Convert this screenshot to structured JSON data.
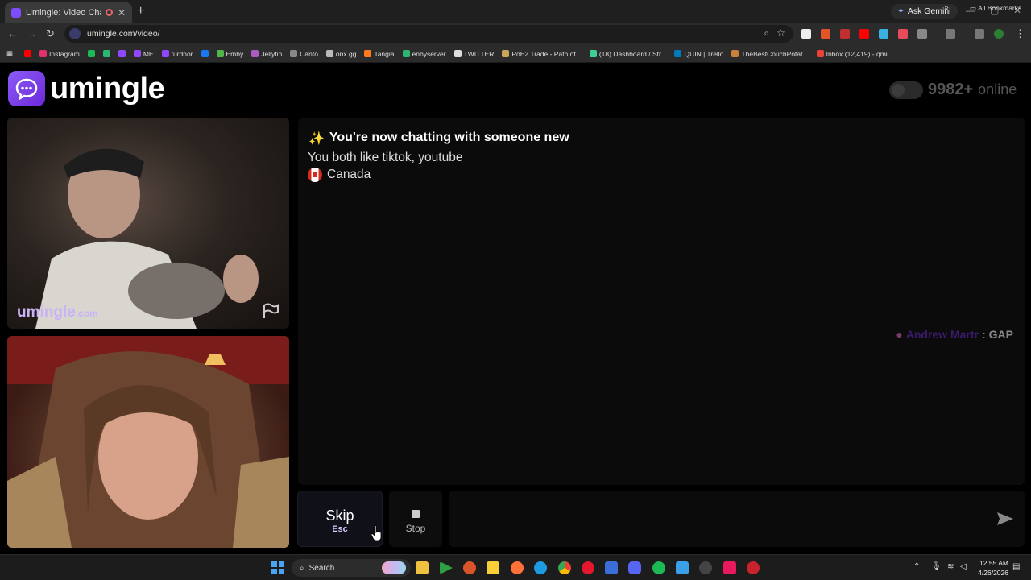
{
  "browser": {
    "tab_title": "Umingle: Video Chat with S",
    "new_tab_label": "+",
    "ask_gemini": "Ask Gemini",
    "url": "umingle.com/video/"
  },
  "bookmarks": [
    {
      "label": "",
      "icon": "youtube-icon",
      "color": "#ff0000"
    },
    {
      "label": "Instagram",
      "icon": "instagram-icon",
      "color": "#e1306c"
    },
    {
      "label": "",
      "icon": "spotify-icon",
      "color": "#1db954"
    },
    {
      "label": "",
      "icon": "bookmark-icon",
      "color": "#2bb673"
    },
    {
      "label": "",
      "icon": "twitch-icon",
      "color": "#9146ff"
    },
    {
      "label": "ME",
      "icon": "twitch-icon",
      "color": "#9146ff"
    },
    {
      "label": "turdnor",
      "icon": "twitch-icon",
      "color": "#9146ff"
    },
    {
      "label": "",
      "icon": "facebook-icon",
      "color": "#1877f2"
    },
    {
      "label": "Emby",
      "icon": "emby-icon",
      "color": "#52b54b"
    },
    {
      "label": "Jellyfin",
      "icon": "jellyfin-icon",
      "color": "#aa5cc3"
    },
    {
      "label": "Canto",
      "icon": "folder-icon",
      "color": "#888888"
    },
    {
      "label": "onx.gg",
      "icon": "onx-icon",
      "color": "#bbbbbb"
    },
    {
      "label": "Tangia",
      "icon": "tangia-icon",
      "color": "#ff7a1a"
    },
    {
      "label": "enbyserver",
      "icon": "server-icon",
      "color": "#2bb673"
    },
    {
      "label": "TWITTER",
      "icon": "x-icon",
      "color": "#dddddd"
    },
    {
      "label": "PoE2 Trade - Path of...",
      "icon": "poe-icon",
      "color": "#c9a55c"
    },
    {
      "label": "(18) Dashboard / Str...",
      "icon": "dashboard-icon",
      "color": "#3ccf91"
    },
    {
      "label": "QUIN | Trello",
      "icon": "trello-icon",
      "color": "#0079bf"
    },
    {
      "label": "TheBestCouchPotat...",
      "icon": "potato-icon",
      "color": "#c9803a"
    },
    {
      "label": "Inbox (12,419) - qmi...",
      "icon": "gmail-icon",
      "color": "#ea4335"
    }
  ],
  "all_bookmarks": "All Bookmarks",
  "app": {
    "logo_text": "umingle",
    "online_count": "9982+",
    "online_word": "online",
    "watermark_main": "umingle",
    "watermark_suffix": ".com"
  },
  "chat": {
    "sparkle": "✨",
    "header": "You're now chatting with someone new",
    "interests": "You both like tiktok, youtube",
    "country": "Canada",
    "message_name": "Andrew Martr",
    "message_sep": ":",
    "message_text": "GAP"
  },
  "controls": {
    "skip_label": "Skip",
    "skip_key": "Esc",
    "stop_label": "Stop",
    "message_placeholder": ""
  },
  "taskbar": {
    "search_label": "Search",
    "time": "12:55 AM",
    "date": "4/26/2026"
  },
  "colors": {
    "brand": "#7c3aed",
    "watermark": "#c8b3f5"
  }
}
